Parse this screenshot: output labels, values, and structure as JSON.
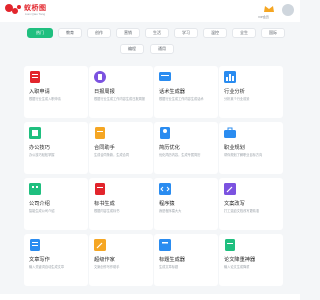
{
  "header": {
    "brand": "蚁桥图",
    "brand_sub": "Lian Qiao Tang",
    "vip_label": "VIP会员"
  },
  "tabs": [
    "热门",
    "教育",
    "创作",
    "营销",
    "生活",
    "学习",
    "温控",
    "全生",
    "国际",
    "编程",
    "通用"
  ],
  "cards": [
    {
      "title": "入职申请",
      "desc": "根据行业生成入职申请"
    },
    {
      "title": "日报周报",
      "desc": "根据行业生成工作内容生成日报周报"
    },
    {
      "title": "话术生成器",
      "desc": "根据行业生成工作内容生成话术"
    },
    {
      "title": "行业分析",
      "desc": "分析某个行业前景"
    },
    {
      "title": "办公技巧",
      "desc": "办公技巧轻松掌握"
    },
    {
      "title": "合同助手",
      "desc": "生成合同条款，生成合同"
    },
    {
      "title": "简历优化",
      "desc": "优化简历内容，生成专属简历"
    },
    {
      "title": "职业规划",
      "desc": "帮你规划了解职业目标方向"
    },
    {
      "title": "公司介绍",
      "desc": "智能生成公司介绍"
    },
    {
      "title": "标书生成",
      "desc": "根据内容生成标书"
    },
    {
      "title": "程序猿",
      "desc": "我是程序猿大大"
    },
    {
      "title": "文案改写",
      "desc": "打工逼迫文档改写更精准"
    },
    {
      "title": "文章写作",
      "desc": "输入关键词自动生成文章"
    },
    {
      "title": "超级作家",
      "desc": "文案创作写作助手"
    },
    {
      "title": "标题生成器",
      "desc": "生成文章标题"
    },
    {
      "title": "论文降重神器",
      "desc": "输入论文生成降重"
    }
  ],
  "colors": {
    "accent": "#1fbf7f",
    "brand": "#e2252c"
  }
}
